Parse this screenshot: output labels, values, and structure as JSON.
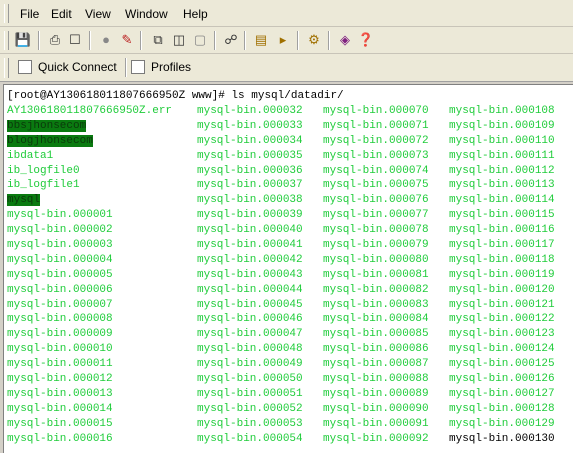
{
  "menu": {
    "file": "File",
    "edit": "Edit",
    "view": "View",
    "window": "Window",
    "help": "Help"
  },
  "toolbar": {
    "icons": [
      "save-icon",
      "print-icon",
      "print-preview-icon",
      "disconnect-icon",
      "connection-icon",
      "copy-icon",
      "paste-icon",
      "clear-icon",
      "find-icon",
      "session-log-icon",
      "send-icon",
      "settings-icon",
      "script-icon",
      "help-icon"
    ]
  },
  "quickbar": {
    "quick_connect": "Quick Connect",
    "profiles": "Profiles"
  },
  "terminal": {
    "prompt": "[root@AY130618011807666950Z www]# ls mysql/datadir/",
    "columns": [
      [
        "AY130618011807666950Z.err",
        "bbsjhonsecom",
        "blogjhonsecom",
        "ibdata1",
        "ib_logfile0",
        "ib_logfile1",
        "mysql",
        "mysql-bin.000001",
        "mysql-bin.000002",
        "mysql-bin.000003",
        "mysql-bin.000004",
        "mysql-bin.000005",
        "mysql-bin.000006",
        "mysql-bin.000007",
        "mysql-bin.000008",
        "mysql-bin.000009",
        "mysql-bin.000010",
        "mysql-bin.000011",
        "mysql-bin.000012",
        "mysql-bin.000013",
        "mysql-bin.000014",
        "mysql-bin.000015",
        "mysql-bin.000016"
      ],
      [
        "mysql-bin.000032",
        "mysql-bin.000033",
        "mysql-bin.000034",
        "mysql-bin.000035",
        "mysql-bin.000036",
        "mysql-bin.000037",
        "mysql-bin.000038",
        "mysql-bin.000039",
        "mysql-bin.000040",
        "mysql-bin.000041",
        "mysql-bin.000042",
        "mysql-bin.000043",
        "mysql-bin.000044",
        "mysql-bin.000045",
        "mysql-bin.000046",
        "mysql-bin.000047",
        "mysql-bin.000048",
        "mysql-bin.000049",
        "mysql-bin.000050",
        "mysql-bin.000051",
        "mysql-bin.000052",
        "mysql-bin.000053",
        "mysql-bin.000054"
      ],
      [
        "mysql-bin.000070",
        "mysql-bin.000071",
        "mysql-bin.000072",
        "mysql-bin.000073",
        "mysql-bin.000074",
        "mysql-bin.000075",
        "mysql-bin.000076",
        "mysql-bin.000077",
        "mysql-bin.000078",
        "mysql-bin.000079",
        "mysql-bin.000080",
        "mysql-bin.000081",
        "mysql-bin.000082",
        "mysql-bin.000083",
        "mysql-bin.000084",
        "mysql-bin.000085",
        "mysql-bin.000086",
        "mysql-bin.000087",
        "mysql-bin.000088",
        "mysql-bin.000089",
        "mysql-bin.000090",
        "mysql-bin.000091",
        "mysql-bin.000092"
      ],
      [
        "mysql-bin.000108",
        "mysql-bin.000109",
        "mysql-bin.000110",
        "mysql-bin.000111",
        "mysql-bin.000112",
        "mysql-bin.000113",
        "mysql-bin.000114",
        "mysql-bin.000115",
        "mysql-bin.000116",
        "mysql-bin.000117",
        "mysql-bin.000118",
        "mysql-bin.000119",
        "mysql-bin.000120",
        "mysql-bin.000121",
        "mysql-bin.000122",
        "mysql-bin.000123",
        "mysql-bin.000124",
        "mysql-bin.000125",
        "mysql-bin.000126",
        "mysql-bin.000127",
        "mysql-bin.000128",
        "mysql-bin.000129",
        "mysql-bin.000130"
      ]
    ],
    "highlighted": [
      "bbsjhonsecom",
      "blogjhonsecom",
      "mysql"
    ],
    "plain": [
      "mysql-bin.000130"
    ]
  },
  "colors": {
    "file_green": "#1fcc3a",
    "dir_highlight": "#0a7a10"
  }
}
